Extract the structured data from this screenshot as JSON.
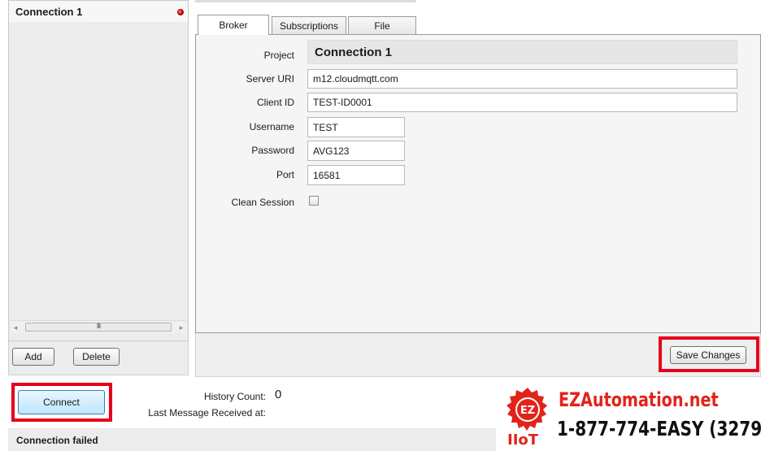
{
  "connections": {
    "items": [
      {
        "name": "Connection 1",
        "status": "error"
      }
    ]
  },
  "left_buttons": {
    "add_label": "Add",
    "delete_label": "Delete"
  },
  "tabs": [
    {
      "label": "Broker",
      "active": true
    },
    {
      "label": "Subscriptions",
      "active": false
    },
    {
      "label": "File",
      "active": false
    }
  ],
  "broker": {
    "project_label": "Project",
    "project_value": "Connection 1",
    "server_uri_label": "Server URI",
    "server_uri_value": "m12.cloudmqtt.com",
    "client_id_label": "Client ID",
    "client_id_value": "TEST-ID0001",
    "username_label": "Username",
    "username_value": "TEST",
    "password_label": "Password",
    "password_value": "AVG123",
    "port_label": "Port",
    "port_value": "16581",
    "clean_session_label": "Clean Session",
    "clean_session_checked": false
  },
  "save_button_label": "Save Changes",
  "connect": {
    "button_label": "Connect",
    "history_count_label": "History Count:",
    "history_count_value": "0",
    "last_message_label": "Last Message Received at:"
  },
  "status": {
    "text": "Connection failed"
  },
  "branding": {
    "logo_letters": "EZ",
    "iiot": "IIoT",
    "site": "EZAutomation.net",
    "phone": "1-877-774-EASY (3279)"
  },
  "colors": {
    "highlight": "#e6001a",
    "brand_red": "#e2231a",
    "status_error": "#d40000"
  }
}
